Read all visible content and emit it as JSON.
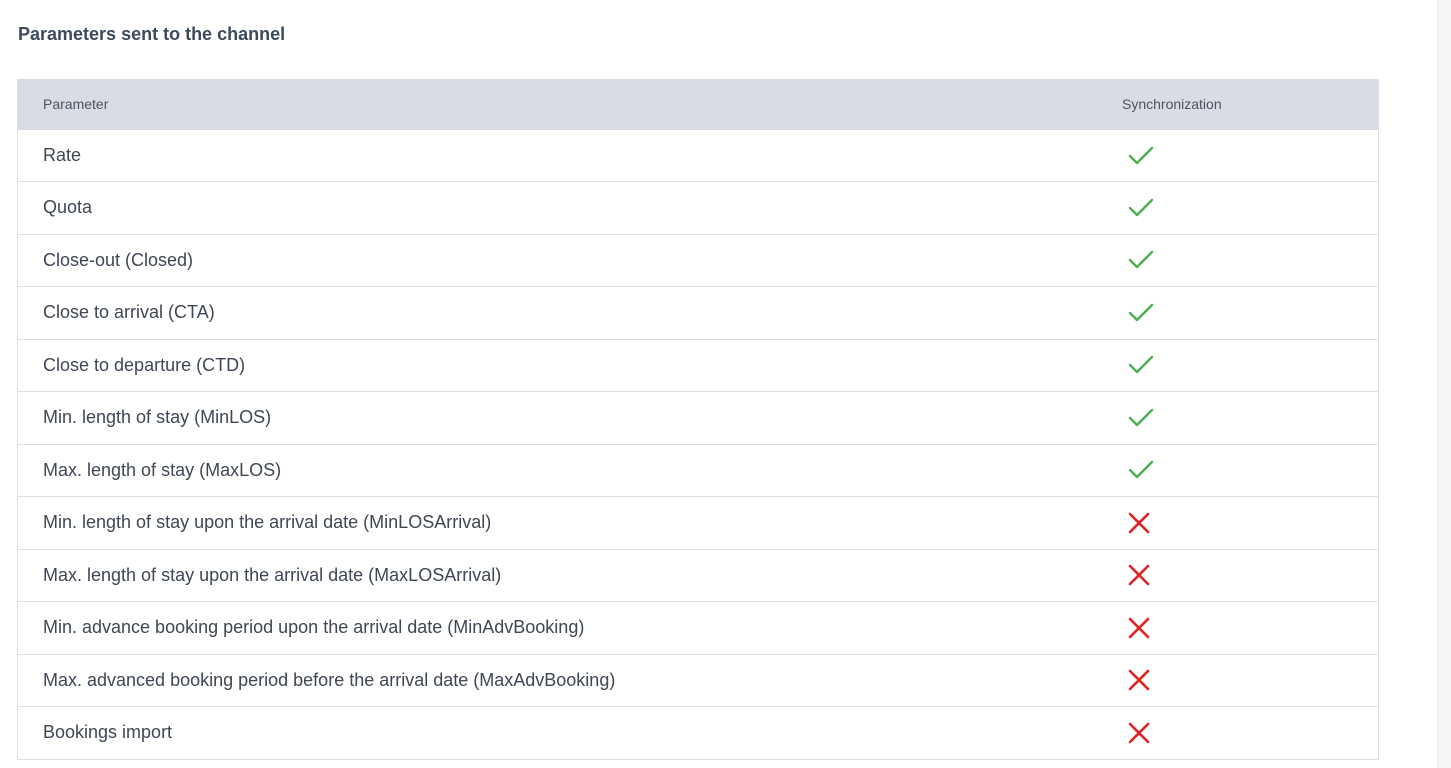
{
  "title": "Parameters sent to the channel",
  "table": {
    "headers": {
      "parameter": "Parameter",
      "synchronization": "Synchronization"
    },
    "rows": [
      {
        "parameter": "Rate",
        "synced": true
      },
      {
        "parameter": "Quota",
        "synced": true
      },
      {
        "parameter": "Close-out (Closed)",
        "synced": true
      },
      {
        "parameter": "Close to arrival (CTA)",
        "synced": true
      },
      {
        "parameter": "Close to departure (CTD)",
        "synced": true
      },
      {
        "parameter": "Min. length of stay (MinLOS)",
        "synced": true
      },
      {
        "parameter": "Max. length of stay (MaxLOS)",
        "synced": true
      },
      {
        "parameter": "Min. length of stay upon the arrival date (MinLOSArrival)",
        "synced": false
      },
      {
        "parameter": "Max. length of stay upon the arrival date (MaxLOSArrival)",
        "synced": false
      },
      {
        "parameter": "Min. advance booking period upon the arrival date (MinAdvBooking)",
        "synced": false
      },
      {
        "parameter": "Max. advanced booking period before the arrival date (MaxAdvBooking)",
        "synced": false
      },
      {
        "parameter": "Bookings import",
        "synced": false
      }
    ]
  },
  "icons": {
    "synced": "checkmark-icon",
    "not_synced": "cross-icon"
  },
  "colors": {
    "check": "#4caf50",
    "cross": "#e02424",
    "header_bg": "#d9dde3",
    "title": "#3d4a5c"
  }
}
